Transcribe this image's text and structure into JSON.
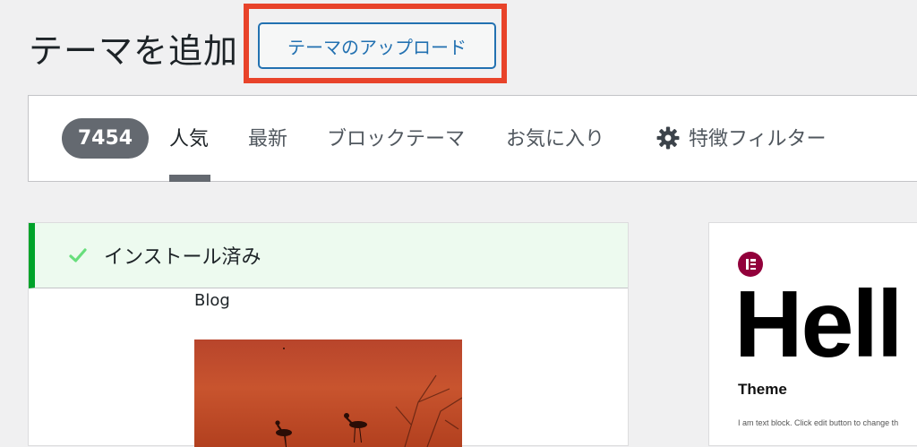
{
  "header": {
    "title": "テーマを追加",
    "upload_button": "テーマのアップロード"
  },
  "filter_bar": {
    "count": "7454",
    "tabs": [
      {
        "label": "人気",
        "active": true
      },
      {
        "label": "最新",
        "active": false
      },
      {
        "label": "ブロックテーマ",
        "active": false
      },
      {
        "label": "お気に入り",
        "active": false
      }
    ],
    "feature_filter": {
      "icon": "gear-icon",
      "label": "特徴フィルター"
    }
  },
  "themes": {
    "installed_card": {
      "status": "インストール済み",
      "status_icon": "checkmark-icon",
      "preview_label": "Blog"
    },
    "hello_card": {
      "logo": "elementor-logo",
      "heading": "Hell",
      "subheading": "Theme",
      "body": "I am text block. Click edit button to change th"
    }
  },
  "colors": {
    "highlight": "#e8432a",
    "accent": "#2271b1",
    "installed_bg": "#edfaef",
    "installed_border": "#00a32a",
    "badge_bg": "#646970"
  }
}
